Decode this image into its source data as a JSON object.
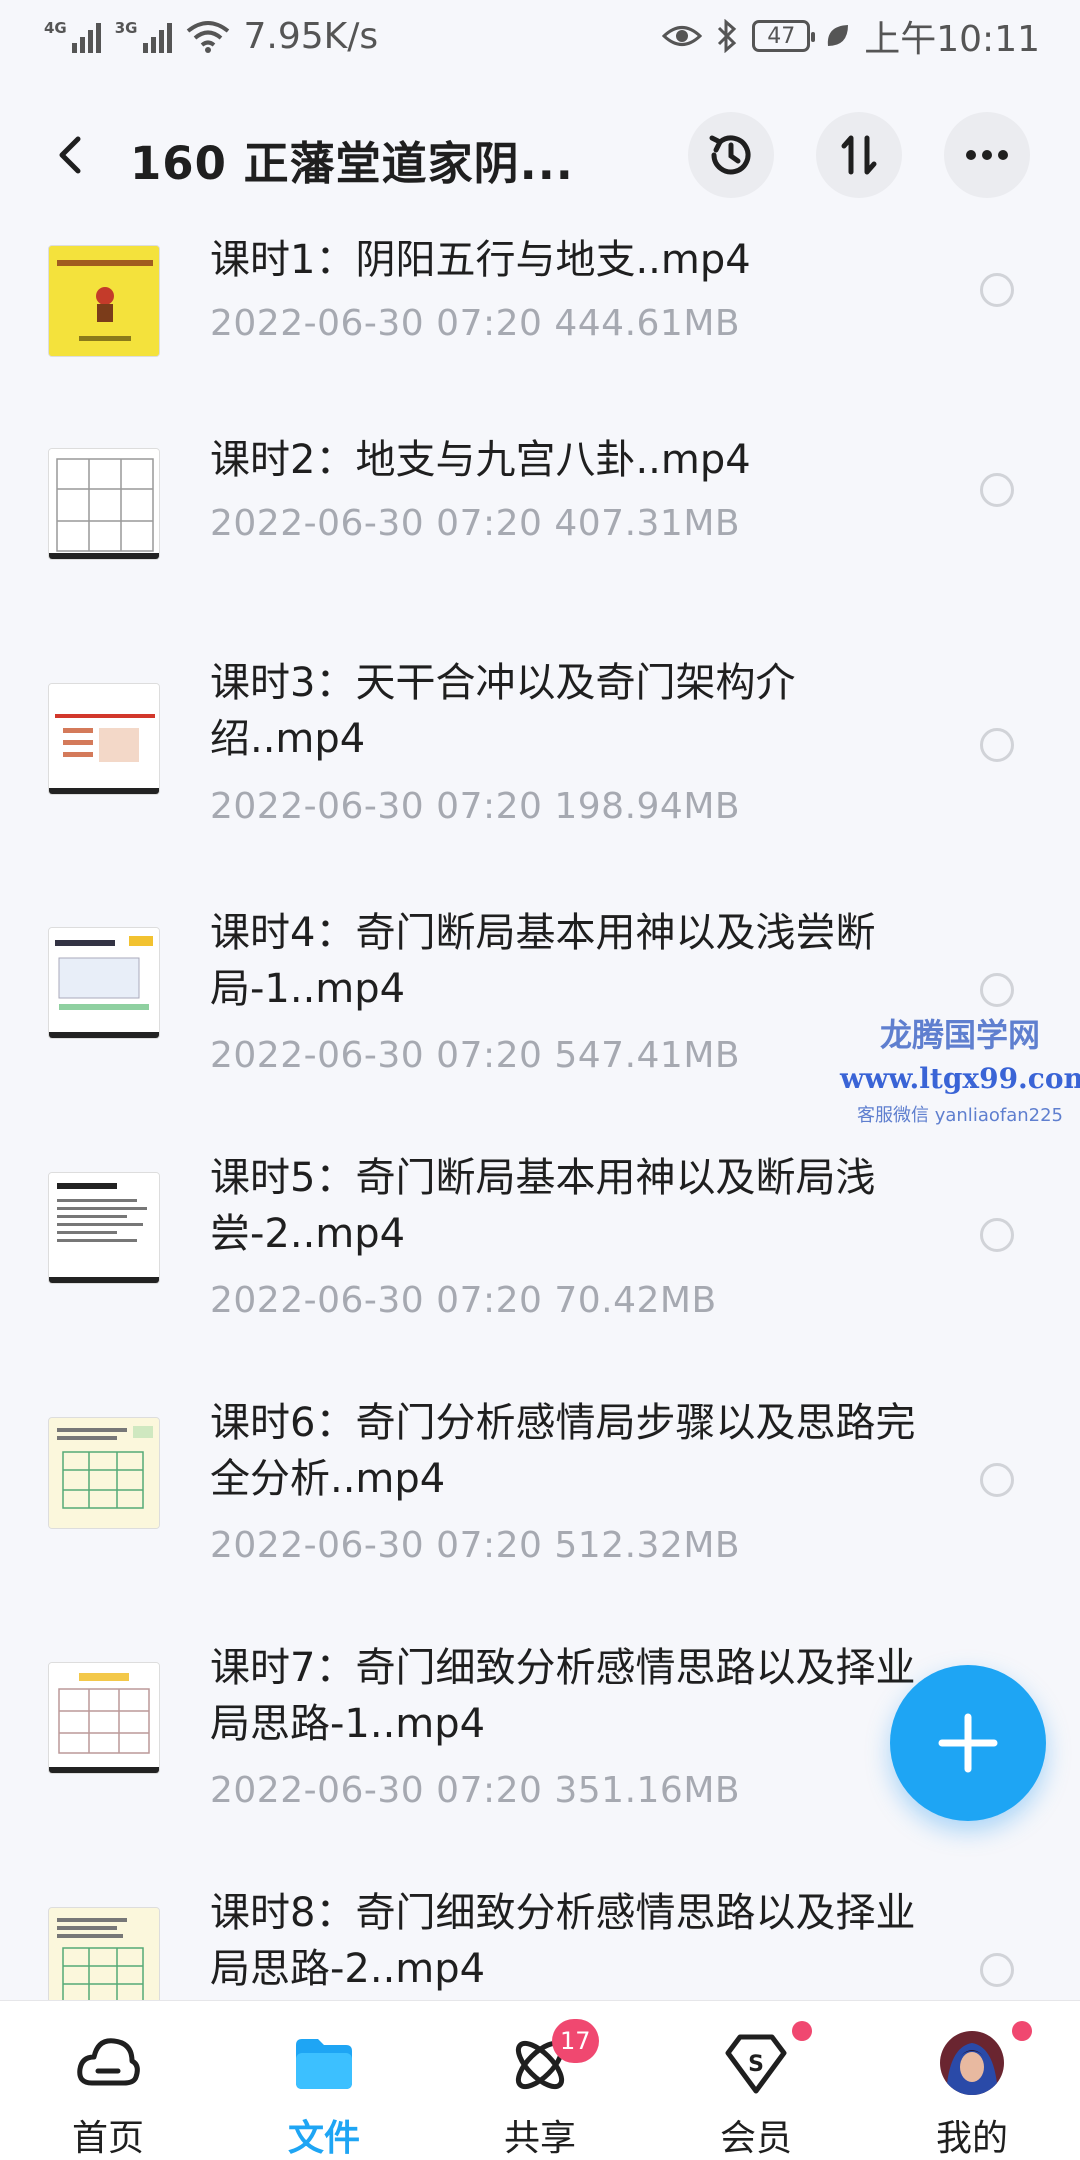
{
  "status_bar": {
    "net1": "4G",
    "net2": "3G",
    "speed": "7.95K/s",
    "battery": "47",
    "time": "上午10:11"
  },
  "header": {
    "title": "160  正藩堂道家阴..."
  },
  "files": [
    {
      "name": "课时1：阴阳五行与地支..mp4",
      "date": "2022-06-30  07:20",
      "size": "444.61MB"
    },
    {
      "name": "课时2：地支与九宫八卦..mp4",
      "date": "2022-06-30  07:20",
      "size": "407.31MB"
    },
    {
      "name": "课时3：天干合冲以及奇门架构介绍..mp4",
      "date": "2022-06-30  07:20",
      "size": "198.94MB"
    },
    {
      "name": "课时4：奇门断局基本用神以及浅尝断局-1..mp4",
      "date": "2022-06-30  07:20",
      "size": "547.41MB"
    },
    {
      "name": "课时5：奇门断局基本用神以及断局浅尝-2..mp4",
      "date": "2022-06-30  07:20",
      "size": "70.42MB"
    },
    {
      "name": "课时6：奇门分析感情局步骤以及思路完全分析..mp4",
      "date": "2022-06-30  07:20",
      "size": "512.32MB"
    },
    {
      "name": "课时7：奇门细致分析感情思路以及择业局思路-1..mp4",
      "date": "2022-06-30  07:20",
      "size": "351.16MB"
    },
    {
      "name": "课时8：奇门细致分析感情思路以及择业局思路-2..mp4",
      "date": "",
      "size": ""
    }
  ],
  "watermark": {
    "line1": "龙腾国学网",
    "line2": "www.ltgx99.com",
    "line3": "客服微信 yanliaofan225"
  },
  "nav": {
    "home": "首页",
    "files": "文件",
    "share": "共享",
    "share_badge": "17",
    "vip": "会员",
    "mine": "我的"
  },
  "colors": {
    "accent": "#1ea5f4",
    "badge": "#f04870",
    "meta_text": "#a6a9b1"
  }
}
